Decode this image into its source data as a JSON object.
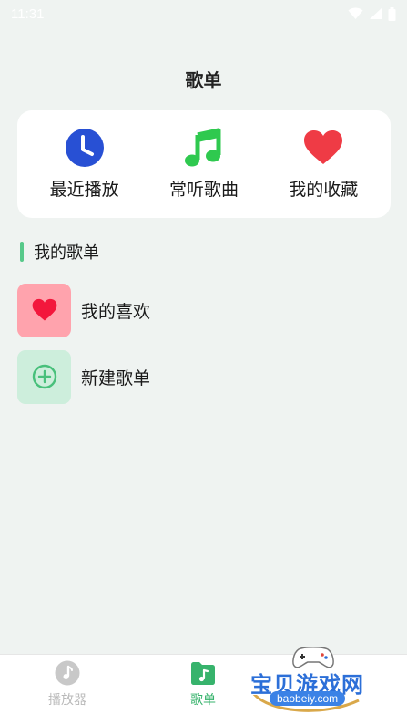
{
  "status_bar": {
    "time": "11:31",
    "icons": [
      "wifi-icon",
      "signal-icon",
      "battery-icon"
    ]
  },
  "header": {
    "title": "歌单"
  },
  "quick_actions": [
    {
      "label": "最近播放",
      "icon": "clock-icon",
      "color": "#2850d4"
    },
    {
      "label": "常听歌曲",
      "icon": "music-note-icon",
      "color": "#2fc94f"
    },
    {
      "label": "我的收藏",
      "icon": "heart-icon",
      "color": "#ef3b45"
    }
  ],
  "my_playlists": {
    "section_title": "我的歌单",
    "items": [
      {
        "label": "我的喜欢",
        "icon": "heart-icon",
        "bg": "#ffa3ad"
      },
      {
        "label": "新建歌单",
        "icon": "plus-circle-icon",
        "bg": "#cdeedc"
      }
    ]
  },
  "bottom_nav": {
    "items": [
      {
        "label": "播放器",
        "icon": "music-disc-icon",
        "active": false
      },
      {
        "label": "歌单",
        "icon": "playlist-folder-icon",
        "active": true
      }
    ],
    "active_color": "#37b36c"
  },
  "watermark": {
    "text": "宝贝游戏网",
    "url": "baobeiy.com"
  }
}
